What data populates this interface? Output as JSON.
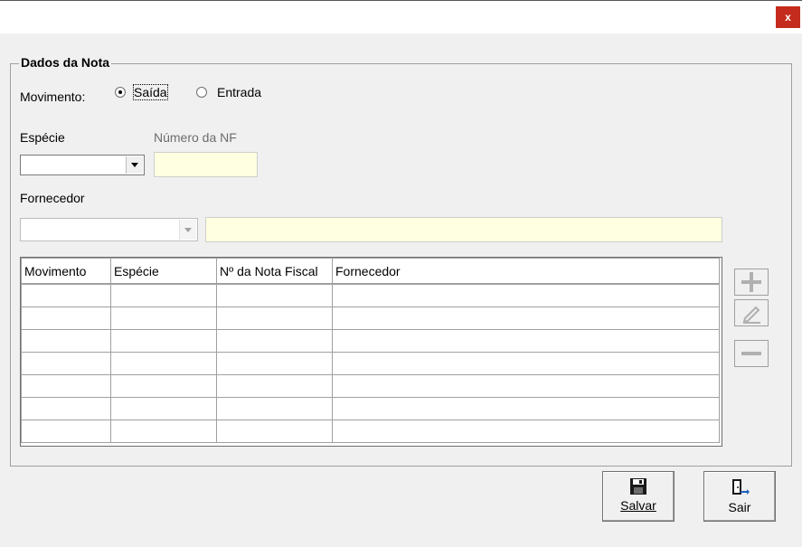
{
  "window": {
    "close_label": "x"
  },
  "group": {
    "title": "Dados da Nota"
  },
  "movimento": {
    "label": "Movimento:",
    "options": [
      {
        "label": "Saída",
        "selected": true
      },
      {
        "label": "Entrada",
        "selected": false
      }
    ]
  },
  "especie": {
    "label": "Espécie",
    "value": ""
  },
  "numero_nf": {
    "label": "Número da NF",
    "value": ""
  },
  "fornecedor": {
    "label": "Fornecedor",
    "combo_value": "",
    "name_value": ""
  },
  "grid": {
    "columns": [
      "Movimento",
      "Espécie",
      "Nº da Nota Fiscal",
      "Fornecedor"
    ],
    "rows": [
      [
        "",
        "",
        "",
        ""
      ],
      [
        "",
        "",
        "",
        ""
      ],
      [
        "",
        "",
        "",
        ""
      ],
      [
        "",
        "",
        "",
        ""
      ],
      [
        "",
        "",
        "",
        ""
      ],
      [
        "",
        "",
        "",
        ""
      ],
      [
        "",
        "",
        "",
        ""
      ]
    ]
  },
  "side_buttons": {
    "add_icon": "plus-icon",
    "edit_icon": "pencil-icon",
    "remove_icon": "minus-icon"
  },
  "buttons": {
    "salvar_label": "Salvar",
    "salvar_icon": "floppy-disk-icon",
    "sair_label": "Sair",
    "sair_icon": "exit-door-icon"
  },
  "colors": {
    "close_button": "#c42b1c",
    "input_background": "#ffffe1",
    "disabled_icon": "#b0b0b0"
  }
}
